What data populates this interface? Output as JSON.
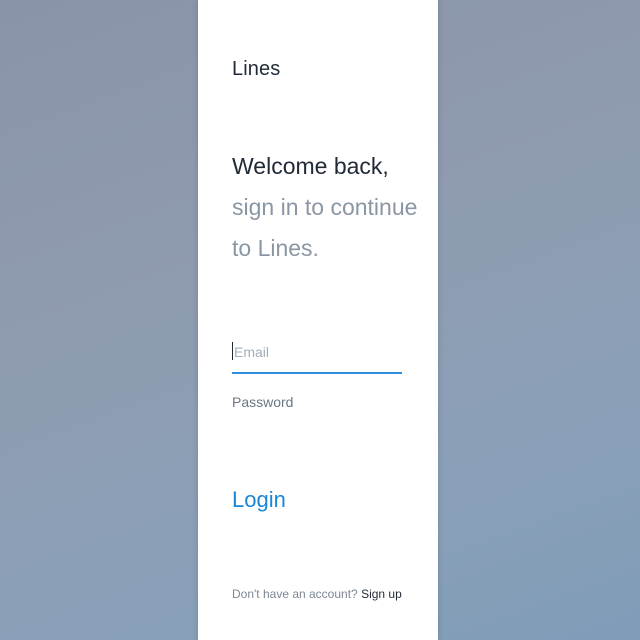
{
  "app": {
    "brand": "Lines"
  },
  "headline": {
    "line1": "Welcome back,",
    "line2": "sign in to continue",
    "line3": "to Lines."
  },
  "form": {
    "email_placeholder": "Email",
    "password_label": "Password",
    "login_label": "Login"
  },
  "footer": {
    "prompt": "Don't have an account?",
    "signup_label": "Sign up"
  },
  "colors": {
    "accent": "#1a86d6",
    "focus_underline": "#2f8fe0",
    "text_primary": "#1f2a36",
    "text_muted": "#8a96a3"
  }
}
